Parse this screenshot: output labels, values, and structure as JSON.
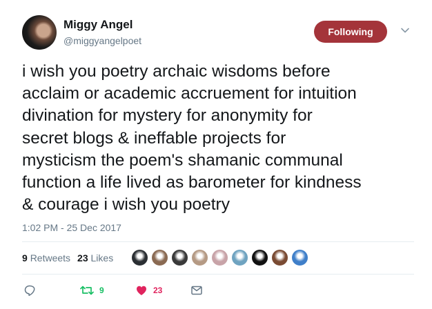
{
  "author": {
    "display_name": "Miggy Angel",
    "handle": "@miggyangelpoet"
  },
  "follow_button": {
    "label": "Following"
  },
  "tweet": {
    "text": "i wish you poetry archaic wisdoms before\nacclaim or academic accruement for intuition\ndivination for mystery for anonymity for\nsecret blogs & ineffable projects for\nmysticism the poem's shamanic communal\nfunction a life lived as barometer for kindness\n& courage i wish you poetry",
    "timestamp": "1:02 PM - 25 Dec 2017"
  },
  "stats": {
    "retweets_count": "9",
    "retweets_label": "Retweets",
    "likes_count": "23",
    "likes_label": "Likes"
  },
  "likers": [
    {
      "name": "liker-avatar-1",
      "color": "#2b2f33"
    },
    {
      "name": "liker-avatar-2",
      "color": "#8a6a52"
    },
    {
      "name": "liker-avatar-3",
      "color": "#3a3a3a"
    },
    {
      "name": "liker-avatar-4",
      "color": "#b59a84"
    },
    {
      "name": "liker-avatar-5",
      "color": "#c8a3a8"
    },
    {
      "name": "liker-avatar-6",
      "color": "#6fa3c0"
    },
    {
      "name": "liker-avatar-7",
      "color": "#111111"
    },
    {
      "name": "liker-avatar-8",
      "color": "#7a4b33"
    },
    {
      "name": "liker-avatar-9",
      "color": "#3f7fc9"
    }
  ],
  "actions": {
    "reply_icon": "reply-icon",
    "retweet_icon": "retweet-icon",
    "retweet_count": "9",
    "like_icon": "heart-icon",
    "like_count": "23",
    "dm_icon": "envelope-icon"
  },
  "colors": {
    "follow_button": "#a4343a",
    "retweet_green": "#17bf63",
    "like_red": "#e0245e",
    "secondary_text": "#657786"
  }
}
